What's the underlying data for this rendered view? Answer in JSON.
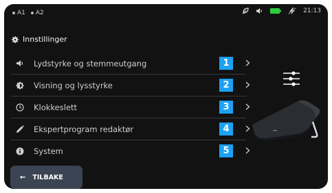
{
  "status": {
    "left_items": [
      "A1",
      "A2"
    ],
    "time": "21:13",
    "icons": [
      "leaf-icon",
      "volume-icon",
      "battery-icon",
      "charging-icon"
    ],
    "battery_color": "#2ecc40"
  },
  "header": {
    "title": "Innstillinger",
    "icon": "gear-icon"
  },
  "menu": {
    "items": [
      {
        "label": "Lydstyrke og stemmeutgang",
        "badge": "1",
        "icon": "volume-icon"
      },
      {
        "label": "Visning og lysstyrke",
        "badge": "2",
        "icon": "brightness-icon"
      },
      {
        "label": "Klokkeslett",
        "badge": "3",
        "icon": "clock-icon"
      },
      {
        "label": "Ekspertprogram redaktør",
        "badge": "4",
        "icon": "pencil-icon"
      },
      {
        "label": "System",
        "badge": "5",
        "icon": "info-icon"
      }
    ]
  },
  "back_button": {
    "label": "TILBAKE",
    "icon": "arrow-left-icon"
  },
  "colors": {
    "background": "#121212",
    "badge": "#1da1f2",
    "button": "#3b4452",
    "divider": "#3a3a3a"
  }
}
